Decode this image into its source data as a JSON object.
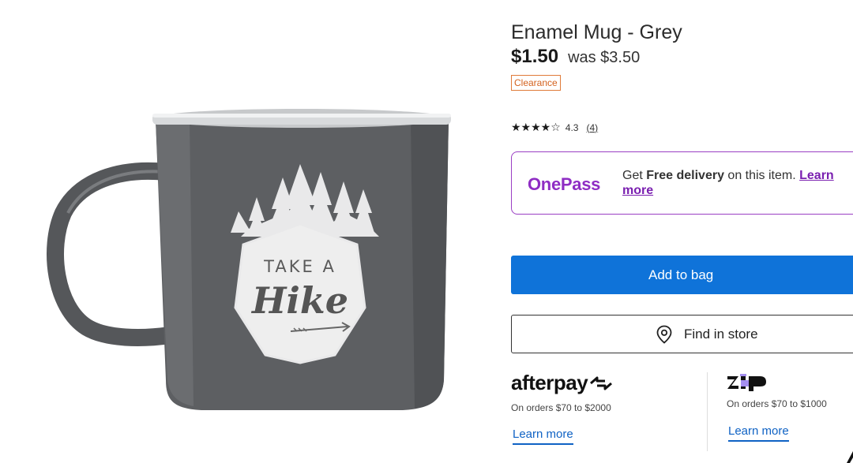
{
  "product": {
    "title": "Enamel Mug - Grey",
    "price": "$1.50",
    "was_price": "was $3.50",
    "badge": "Clearance",
    "image_text": {
      "line1": "TAKE A",
      "line2": "Hike"
    }
  },
  "rating": {
    "stars": "★★★★☆",
    "value": "4.3",
    "count": "(4)"
  },
  "onepass": {
    "logo": "OnePass",
    "text_prefix": "Get ",
    "text_bold": "Free delivery",
    "text_suffix": " on this item. ",
    "link_part1": "Learn",
    "link_part2": "more"
  },
  "actions": {
    "add_to_bag": "Add to bag",
    "find_in_store": "Find in store"
  },
  "afterpay": {
    "logo": "afterpay",
    "note": "On orders $70 to $2000",
    "learn_more": "Learn more"
  },
  "zip": {
    "logo": "zip",
    "note": "On orders $70 to $1000",
    "learn_more": "Learn more"
  },
  "colors": {
    "primary_button": "#0f73d9",
    "onepass_purple": "#8f2dc4",
    "clearance_orange": "#d4621e",
    "mug_grey": "#5d5f62"
  }
}
